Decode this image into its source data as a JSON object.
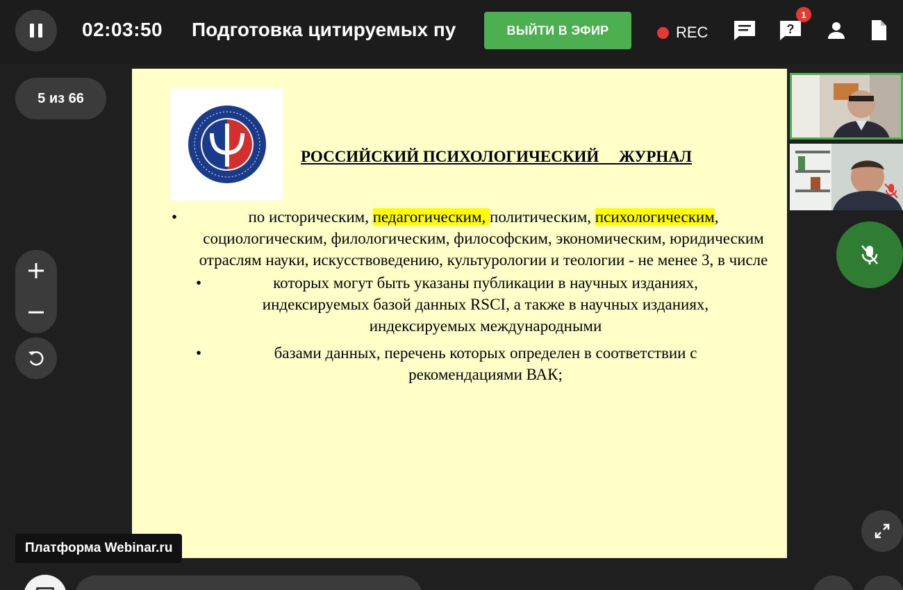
{
  "header": {
    "timer": "02:03:50",
    "title": "Подготовка цитируемых пу",
    "live_button": "ВЫЙТИ В ЭФИР",
    "rec_label": "REC",
    "notification_count": "1",
    "icons": [
      "pause-icon",
      "chat-icon",
      "question-icon",
      "person-icon",
      "document-icon"
    ]
  },
  "controls": {
    "page_indicator": "5 из 66",
    "zoom_in": "+",
    "zoom_out": "−"
  },
  "slide": {
    "title": "РОССИЙСКИЙ ПСИХОЛОГИЧЕСКИЙ     ЖУРНАЛ",
    "logo_text": "ОБЩЕСТВО РОССИЙСКОЕ ПСИХОЛОГИЧЕСКОЕ",
    "bullet1": {
      "bullet": "•",
      "pre": "по историческим, ",
      "hl1": "педагогическим, ",
      "mid": "политическим, ",
      "hl2": "психологическим",
      "post": ", социологическим, филологическим, философским, экономическим, юридическим отраслям науки, искусствоведению, культурологии и теологии - не менее 3, в числе"
    },
    "bullet2": {
      "bullet": "•",
      "text": "которых могут быть указаны публикации в научных изданиях, индексируемых базой данных RSCI, а также в научных изданиях, индексируемых международными"
    },
    "bullet3": {
      "bullet": "•",
      "text": "базами данных, перечень которых определен в соответствии с рекомендациями ВАК;"
    }
  },
  "watermark": "Платформа Webinar.ru",
  "colors": {
    "accent": "#4caf50",
    "rec": "#e53935",
    "slide_bg": "#ffffc8",
    "highlight": "#ffff00"
  }
}
